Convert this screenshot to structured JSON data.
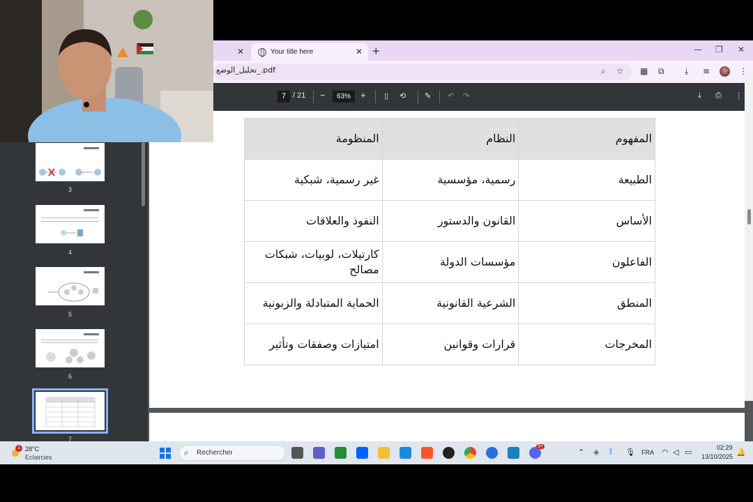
{
  "browser": {
    "tabs": [
      {
        "label": ""
      },
      {
        "label": "Your title here"
      }
    ],
    "url": "تحليل_الوضع_.pdf"
  },
  "pdf_toolbar": {
    "current_page": "7",
    "page_total": "/ 21",
    "zoom": "63%"
  },
  "sidebar": {
    "thumbnails": [
      {
        "page": "3"
      },
      {
        "page": "4"
      },
      {
        "page": "5"
      },
      {
        "page": "6"
      },
      {
        "page": "7",
        "selected": true
      }
    ]
  },
  "document": {
    "table": {
      "headers": [
        "المفهوم",
        "النظام",
        "المنظومة"
      ],
      "rows": [
        [
          "الطبيعة",
          "رسمية، مؤسسية",
          "غير رسمية، شبكية"
        ],
        [
          "الأساس",
          "القانون والدستور",
          "النفوذ والعلاقات"
        ],
        [
          "الفاعلون",
          "مؤسسات الدولة",
          "كارتيلات، لوبيات، شبكات مصالح"
        ],
        [
          "المنطق",
          "الشرعية القانونية",
          "الحماية المتبادلة والزبونية"
        ],
        [
          "المخرجات",
          "قرارات وقوانين",
          "امتيازات وصفقات وتأثير"
        ]
      ]
    }
  },
  "taskbar": {
    "weather_temp": "28°C",
    "weather_desc": "Eclaircies",
    "weather_badge": "1",
    "search_placeholder": "Rechercher",
    "language": "FRA",
    "time": "02:29",
    "date": "13/10/2025",
    "discord_badge": "9+"
  },
  "colors": {
    "tabstrip": "#e9d7f3",
    "pdf_toolbar": "#323639",
    "viewer_bg": "#525659",
    "thumb_selected": "#8ab4f8",
    "table_header": "#e0e0e0"
  }
}
